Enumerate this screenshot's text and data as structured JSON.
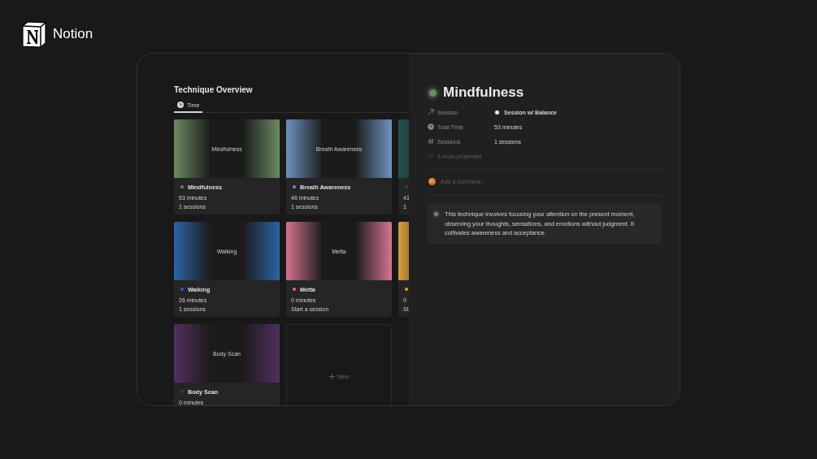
{
  "logo": {
    "text": "Notion"
  },
  "gallery": {
    "title": "Technique Overview",
    "tabs": [
      {
        "label": "Time",
        "selected": true
      }
    ],
    "cards": [
      {
        "kind": "card",
        "cover_label": "Mindfulness",
        "title": "Mindfulness",
        "color": "#6a8a62",
        "lines": [
          "53 minutes",
          "1 sessions"
        ]
      },
      {
        "kind": "card",
        "cover_label": "Breath Awareness",
        "title": "Breath Awareness",
        "color": "#6f93bd",
        "lines": [
          "46 minutes",
          "1 sessions"
        ]
      },
      {
        "kind": "card",
        "color": "#24524f",
        "lines": [
          "41",
          "1"
        ]
      },
      {
        "kind": "card",
        "cover_label": "Walking",
        "title": "Walking",
        "color": "#2b63a6",
        "lines": [
          "26 minutes",
          "1 sessions"
        ]
      },
      {
        "kind": "card",
        "cover_label": "Metta",
        "title": "Metta",
        "color": "#d5748f",
        "lines": [
          "0 minutes",
          "Start a session"
        ]
      },
      {
        "kind": "card",
        "color": "#d9a03e",
        "lines": [
          "0",
          "St"
        ]
      },
      {
        "kind": "card",
        "cover_label": "Body Scan",
        "title": "Body Scan",
        "color": "#52305e",
        "lines": [
          "0 minutes"
        ]
      },
      {
        "kind": "new",
        "label": "New"
      }
    ]
  },
  "detail": {
    "title": "Mindfulness",
    "properties": [
      {
        "kind": "relation",
        "label": "Session",
        "value": "Session w/ Balance"
      },
      {
        "kind": "time",
        "label": "Total Time",
        "value": "53 minutes"
      },
      {
        "kind": "number",
        "label": "Sessions",
        "value": "1 sessions"
      }
    ],
    "more": "3 more properties",
    "comment_placeholder": "Add a comment...",
    "callout": "This technique involves focusing your attention on the present moment, observing your thoughts, sensations, and emotions without judgment. It cultivates awareness and acceptance."
  }
}
